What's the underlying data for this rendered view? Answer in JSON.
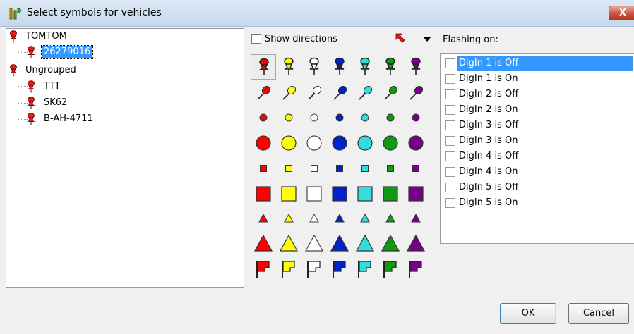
{
  "window": {
    "title": "Select symbols for vehicles",
    "close_label": "X"
  },
  "tree": {
    "nodes": [
      {
        "label": "TOMTOM",
        "level": 0
      },
      {
        "label": "26279016",
        "level": 1,
        "selected": true
      },
      {
        "label": "Ungrouped",
        "level": 0
      },
      {
        "label": "TTT",
        "level": 1
      },
      {
        "label": "SK62",
        "level": 1
      },
      {
        "label": "B-AH-4711",
        "level": 1
      }
    ]
  },
  "symbols": {
    "show_directions_label": "Show directions",
    "show_directions_checked": false,
    "direction_icon": "arrow-up-left-icon",
    "colors": [
      "#ff0000",
      "#ffff00",
      "#ffffff",
      "#0022cc",
      "#33dddd",
      "#119911",
      "#770088"
    ],
    "rows": [
      "pushpin",
      "pin",
      "small-circle",
      "large-circle",
      "small-square",
      "large-square",
      "small-triangle",
      "large-triangle",
      "flag"
    ],
    "selected": {
      "row": 0,
      "col": 0
    }
  },
  "flashing": {
    "label": "Flashing on:",
    "items": [
      {
        "label": "DigIn 1 is Off",
        "checked": false,
        "selected": true
      },
      {
        "label": "DigIn 1 is On",
        "checked": false
      },
      {
        "label": "DigIn 2 is Off",
        "checked": false
      },
      {
        "label": "DigIn 2 is On",
        "checked": false
      },
      {
        "label": "DigIn 3 is Off",
        "checked": false
      },
      {
        "label": "DigIn 3 is On",
        "checked": false
      },
      {
        "label": "DigIn 4 is Off",
        "checked": false
      },
      {
        "label": "DigIn 4 is On",
        "checked": false
      },
      {
        "label": "DigIn 5 is Off",
        "checked": false
      },
      {
        "label": "DigIn 5 is On",
        "checked": false
      }
    ]
  },
  "buttons": {
    "ok_label": "OK",
    "cancel_label": "Cancel"
  }
}
